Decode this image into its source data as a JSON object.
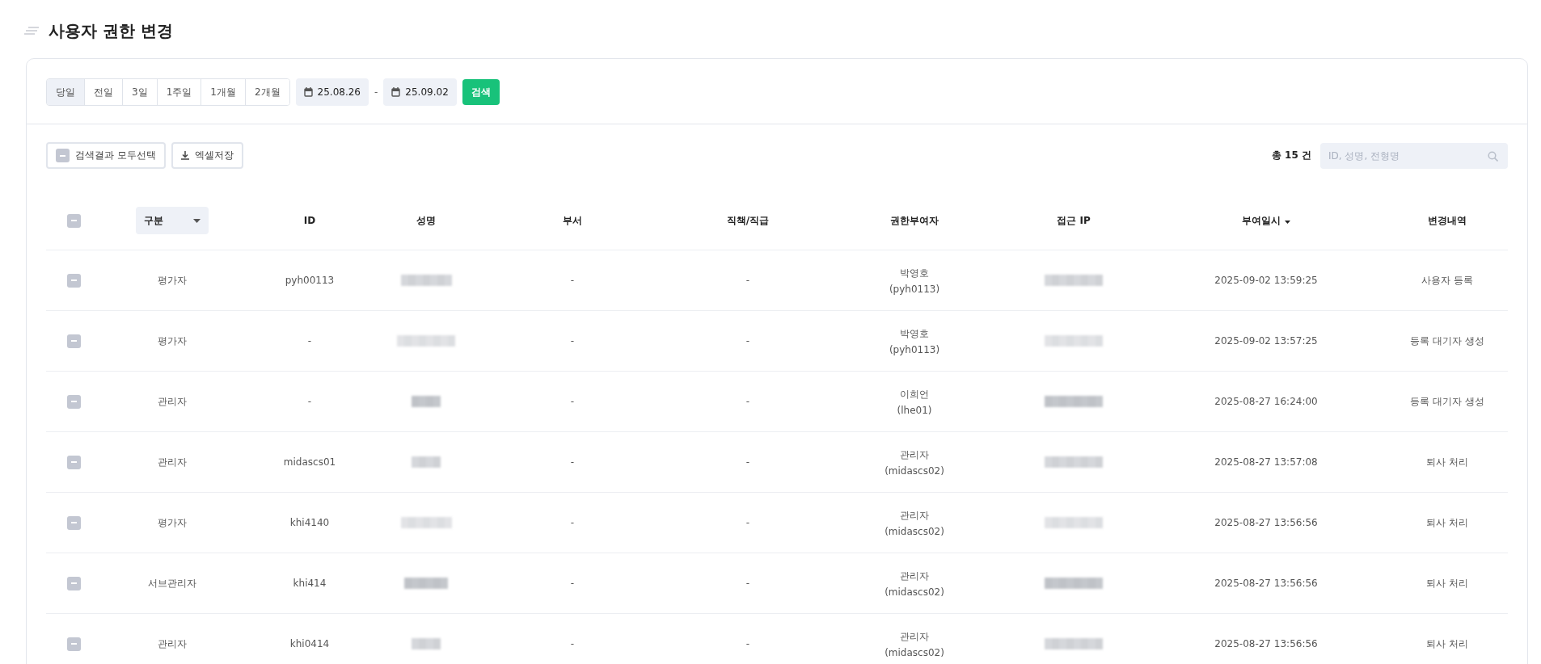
{
  "page": {
    "title": "사용자 권한 변경"
  },
  "filter": {
    "periods": [
      {
        "label": "당일",
        "selected": true
      },
      {
        "label": "전일",
        "selected": false
      },
      {
        "label": "3일",
        "selected": false
      },
      {
        "label": "1주일",
        "selected": false
      },
      {
        "label": "1개월",
        "selected": false
      },
      {
        "label": "2개월",
        "selected": false
      }
    ],
    "date_from": "25.08.26",
    "separator": "-",
    "date_to": "25.09.02",
    "search_button": "검색"
  },
  "actions": {
    "select_all": {
      "label": "검색결과 모두선택",
      "checked": false
    },
    "excel": "엑셀저장",
    "total": "총 15 건",
    "search": {
      "placeholder": "ID, 성명, 전형명"
    }
  },
  "table": {
    "header_checked": false,
    "columns": [
      "구분",
      "ID",
      "성명",
      "부서",
      "직책/직급",
      "권한부여자",
      "접근 IP",
      "부여일시",
      "변경내역"
    ],
    "rows": [
      {
        "checked": false,
        "type": "평가자",
        "id": "pyh00113",
        "dept": "-",
        "position": "-",
        "granter": "박영호",
        "granter_id": "(pyh0113)",
        "granted_at": "2025-09-02 13:59:25",
        "change": "사용자 등록"
      },
      {
        "checked": false,
        "type": "평가자",
        "id": "-",
        "dept": "-",
        "position": "-",
        "granter": "박영호",
        "granter_id": "(pyh0113)",
        "granted_at": "2025-09-02 13:57:25",
        "change": "등록 대기자 생성"
      },
      {
        "checked": false,
        "type": "관리자",
        "id": "-",
        "dept": "-",
        "position": "-",
        "granter": "이희언",
        "granter_id": "(lhe01)",
        "granted_at": "2025-08-27 16:24:00",
        "change": "등록 대기자 생성"
      },
      {
        "checked": false,
        "type": "관리자",
        "id": "midascs01",
        "dept": "-",
        "position": "-",
        "granter": "관리자",
        "granter_id": "(midascs02)",
        "granted_at": "2025-08-27 13:57:08",
        "change": "퇴사 처리"
      },
      {
        "checked": false,
        "type": "평가자",
        "id": "khi4140",
        "dept": "-",
        "position": "-",
        "granter": "관리자",
        "granter_id": "(midascs02)",
        "granted_at": "2025-08-27 13:56:56",
        "change": "퇴사 처리"
      },
      {
        "checked": false,
        "type": "서브관리자",
        "id": "khi414",
        "dept": "-",
        "position": "-",
        "granter": "관리자",
        "granter_id": "(midascs02)",
        "granted_at": "2025-08-27 13:56:56",
        "change": "퇴사 처리"
      },
      {
        "checked": false,
        "type": "관리자",
        "id": "khi0414",
        "dept": "-",
        "position": "-",
        "granter": "관리자",
        "granter_id": "(midascs02)",
        "granted_at": "2025-08-27 13:56:56",
        "change": "퇴사 처리"
      }
    ]
  }
}
